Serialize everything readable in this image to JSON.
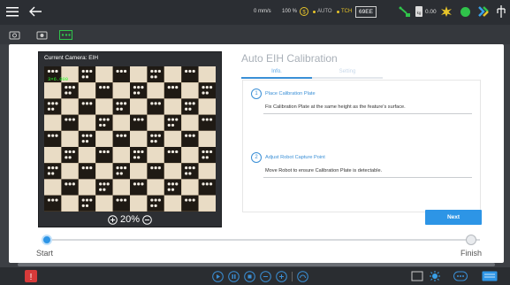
{
  "topbar": {
    "speed": "0 mm/s",
    "percent": "100 %",
    "auto": "AUTO",
    "tch": "TCH",
    "code": "69EE",
    "value": "0.00"
  },
  "camera": {
    "header": "Current Camera:  EIH",
    "overlay": "3×6.000",
    "zoom": "20%"
  },
  "panel": {
    "title": "Auto EIH Calibration",
    "tabs": [
      "Info.",
      "Setting"
    ]
  },
  "steps": [
    {
      "number": "1",
      "title": "Place Calibration Plate",
      "desc": "Fix Calibration Plate at the same height as the feature's surface."
    },
    {
      "number": "2",
      "title": "Adjust Robot Capture Point",
      "desc": "Move Robot to ensure Calibration Plate is detectable."
    }
  ],
  "buttons": {
    "next": "Next"
  },
  "progress": {
    "start": "Start",
    "finish": "Finish",
    "value": 0
  },
  "colors": {
    "accent": "#2d95e6",
    "green": "#30c44b",
    "status_yellow": "#e8c52a"
  }
}
